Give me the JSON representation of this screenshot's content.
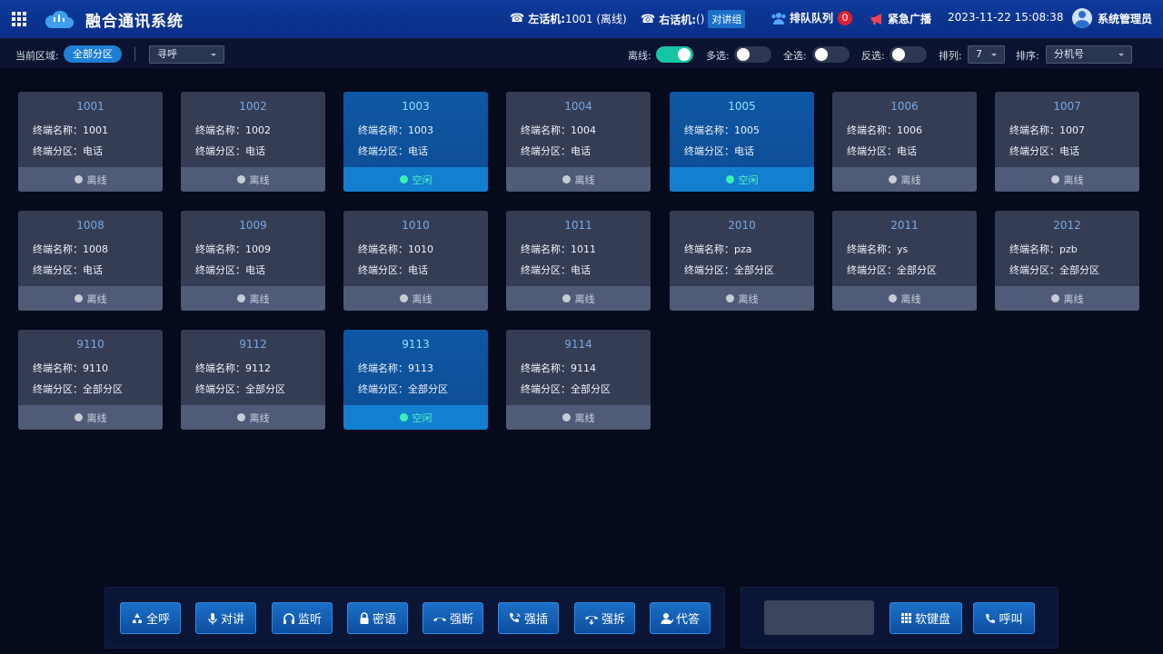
{
  "header": {
    "title": "融合通讯系统",
    "left_phone_label": "左话机:",
    "left_phone_value": "1001 (离线)",
    "right_phone_label": "右话机:",
    "right_phone_value": "()",
    "intercom_group": "对讲组",
    "queue_label": "排队队列",
    "queue_count": "0",
    "broadcast_label": "紧急广播",
    "datetime": "2023-11-22 15:08:38",
    "user": "系统管理员"
  },
  "toolbar": {
    "area_label": "当前区域:",
    "area_value": "全部分区",
    "mode_select": "寻呼",
    "offline_label": "离线:",
    "offline_on": true,
    "multi_label": "多选:",
    "multi_on": false,
    "all_label": "全选:",
    "all_on": false,
    "invert_label": "反选:",
    "invert_on": false,
    "columns_label": "排列:",
    "columns_value": "7",
    "sort_label": "排序:",
    "sort_value": "分机号"
  },
  "terminals": [
    {
      "num": "1001",
      "name": "终端名称：1001",
      "zone": "终端分区：电话",
      "status": "离线",
      "idle": false
    },
    {
      "num": "1002",
      "name": "终端名称：1002",
      "zone": "终端分区：电话",
      "status": "离线",
      "idle": false
    },
    {
      "num": "1003",
      "name": "终端名称：1003",
      "zone": "终端分区：电话",
      "status": "空闲",
      "idle": true
    },
    {
      "num": "1004",
      "name": "终端名称：1004",
      "zone": "终端分区：电话",
      "status": "离线",
      "idle": false
    },
    {
      "num": "1005",
      "name": "终端名称：1005",
      "zone": "终端分区：电话",
      "status": "空闲",
      "idle": true
    },
    {
      "num": "1006",
      "name": "终端名称：1006",
      "zone": "终端分区：电话",
      "status": "离线",
      "idle": false
    },
    {
      "num": "1007",
      "name": "终端名称：1007",
      "zone": "终端分区：电话",
      "status": "离线",
      "idle": false
    },
    {
      "num": "1008",
      "name": "终端名称：1008",
      "zone": "终端分区：电话",
      "status": "离线",
      "idle": false
    },
    {
      "num": "1009",
      "name": "终端名称：1009",
      "zone": "终端分区：电话",
      "status": "离线",
      "idle": false
    },
    {
      "num": "1010",
      "name": "终端名称：1010",
      "zone": "终端分区：电话",
      "status": "离线",
      "idle": false
    },
    {
      "num": "1011",
      "name": "终端名称：1011",
      "zone": "终端分区：电话",
      "status": "离线",
      "idle": false
    },
    {
      "num": "2010",
      "name": "终端名称：pza",
      "zone": "终端分区：全部分区",
      "status": "离线",
      "idle": false
    },
    {
      "num": "2011",
      "name": "终端名称：ys",
      "zone": "终端分区：全部分区",
      "status": "离线",
      "idle": false
    },
    {
      "num": "2012",
      "name": "终端名称：pzb",
      "zone": "终端分区：全部分区",
      "status": "离线",
      "idle": false
    },
    {
      "num": "9110",
      "name": "终端名称：9110",
      "zone": "终端分区：全部分区",
      "status": "离线",
      "idle": false
    },
    {
      "num": "9112",
      "name": "终端名称：9112",
      "zone": "终端分区：全部分区",
      "status": "离线",
      "idle": false
    },
    {
      "num": "9113",
      "name": "终端名称：9113",
      "zone": "终端分区：全部分区",
      "status": "空闲",
      "idle": true
    },
    {
      "num": "9114",
      "name": "终端名称：9114",
      "zone": "终端分区：全部分区",
      "status": "离线",
      "idle": false
    }
  ],
  "actions": [
    {
      "label": "全呼",
      "icon": "recycle-icon"
    },
    {
      "label": "对讲",
      "icon": "microphone-icon"
    },
    {
      "label": "监听",
      "icon": "headphones-icon"
    },
    {
      "label": "密语",
      "icon": "lock-icon"
    },
    {
      "label": "强断",
      "icon": "hangup-icon"
    },
    {
      "label": "强插",
      "icon": "phone-volume-icon"
    },
    {
      "label": "强拆",
      "icon": "phone-split-icon"
    },
    {
      "label": "代答",
      "icon": "user-answer-icon"
    }
  ],
  "dial": {
    "input_value": "",
    "keypad_label": "软键盘",
    "call_label": "呼叫"
  },
  "colors": {
    "header_bg": "#0a2f86",
    "card_offline": "#353d55",
    "card_idle": "#0c4c93",
    "idle_green": "#3ff0b6",
    "switch_on": "#17c3a5"
  }
}
